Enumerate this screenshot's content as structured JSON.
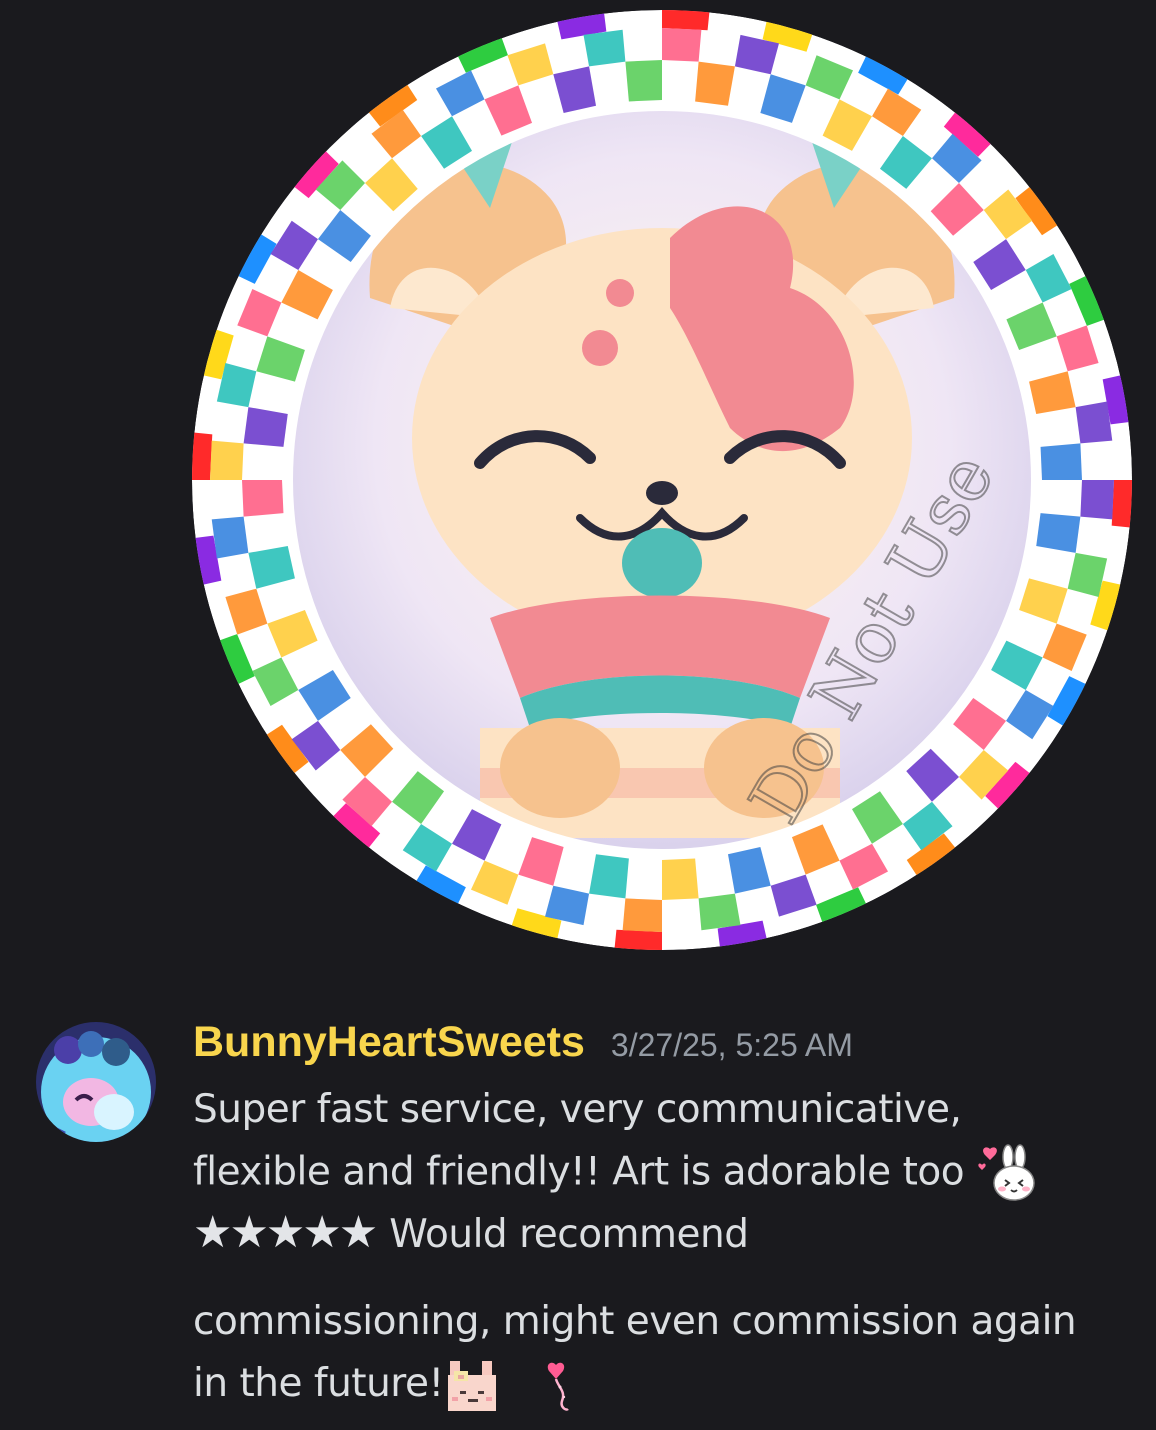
{
  "attachment": {
    "kind": "image",
    "watermark_text": "Do Not Use"
  },
  "message": {
    "author": {
      "username": "BunnyHeartSweets",
      "username_color": "#f8d54d",
      "avatar_icon": "avatar-image"
    },
    "timestamp": "3/27/25, 5:25 AM",
    "lines": [
      "Super fast service, very communicative,",
      "flexible and friendly!! Art is adorable too",
      "Would recommend",
      "commissioning, might even commission again",
      "in the future!"
    ],
    "rating_stars": "★★★★★",
    "rating_value": 5,
    "emojis": [
      "bunny-heart-emoji",
      "pixel-bunny-emoji",
      "heart-balloon-emoji"
    ]
  },
  "colors": {
    "background": "#1a1a1e",
    "text": "#dbdee1",
    "muted": "#949ba4"
  }
}
